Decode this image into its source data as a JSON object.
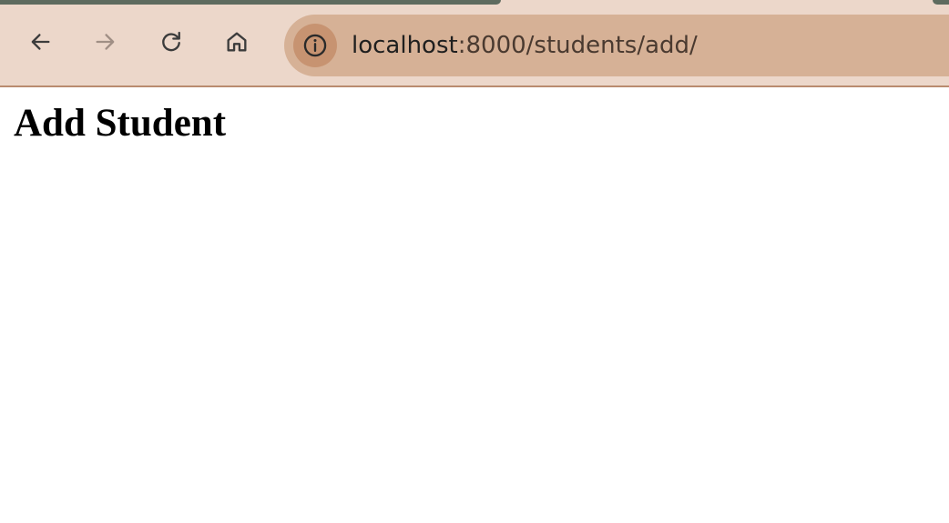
{
  "browser": {
    "url_host": "localhost",
    "url_path": ":8000/students/add/",
    "icons": {
      "back": "arrow-left-icon",
      "forward": "arrow-right-icon",
      "reload": "reload-icon",
      "home": "home-icon",
      "site_info": "info-icon"
    },
    "colors": {
      "toolbar": "#ecd7ca",
      "omnibox": "#d6b196",
      "site_info_bg": "#c79371",
      "divider": "#b98b6f",
      "tab_accent": "#5e6b5f"
    }
  },
  "page": {
    "title": "Add Student"
  }
}
